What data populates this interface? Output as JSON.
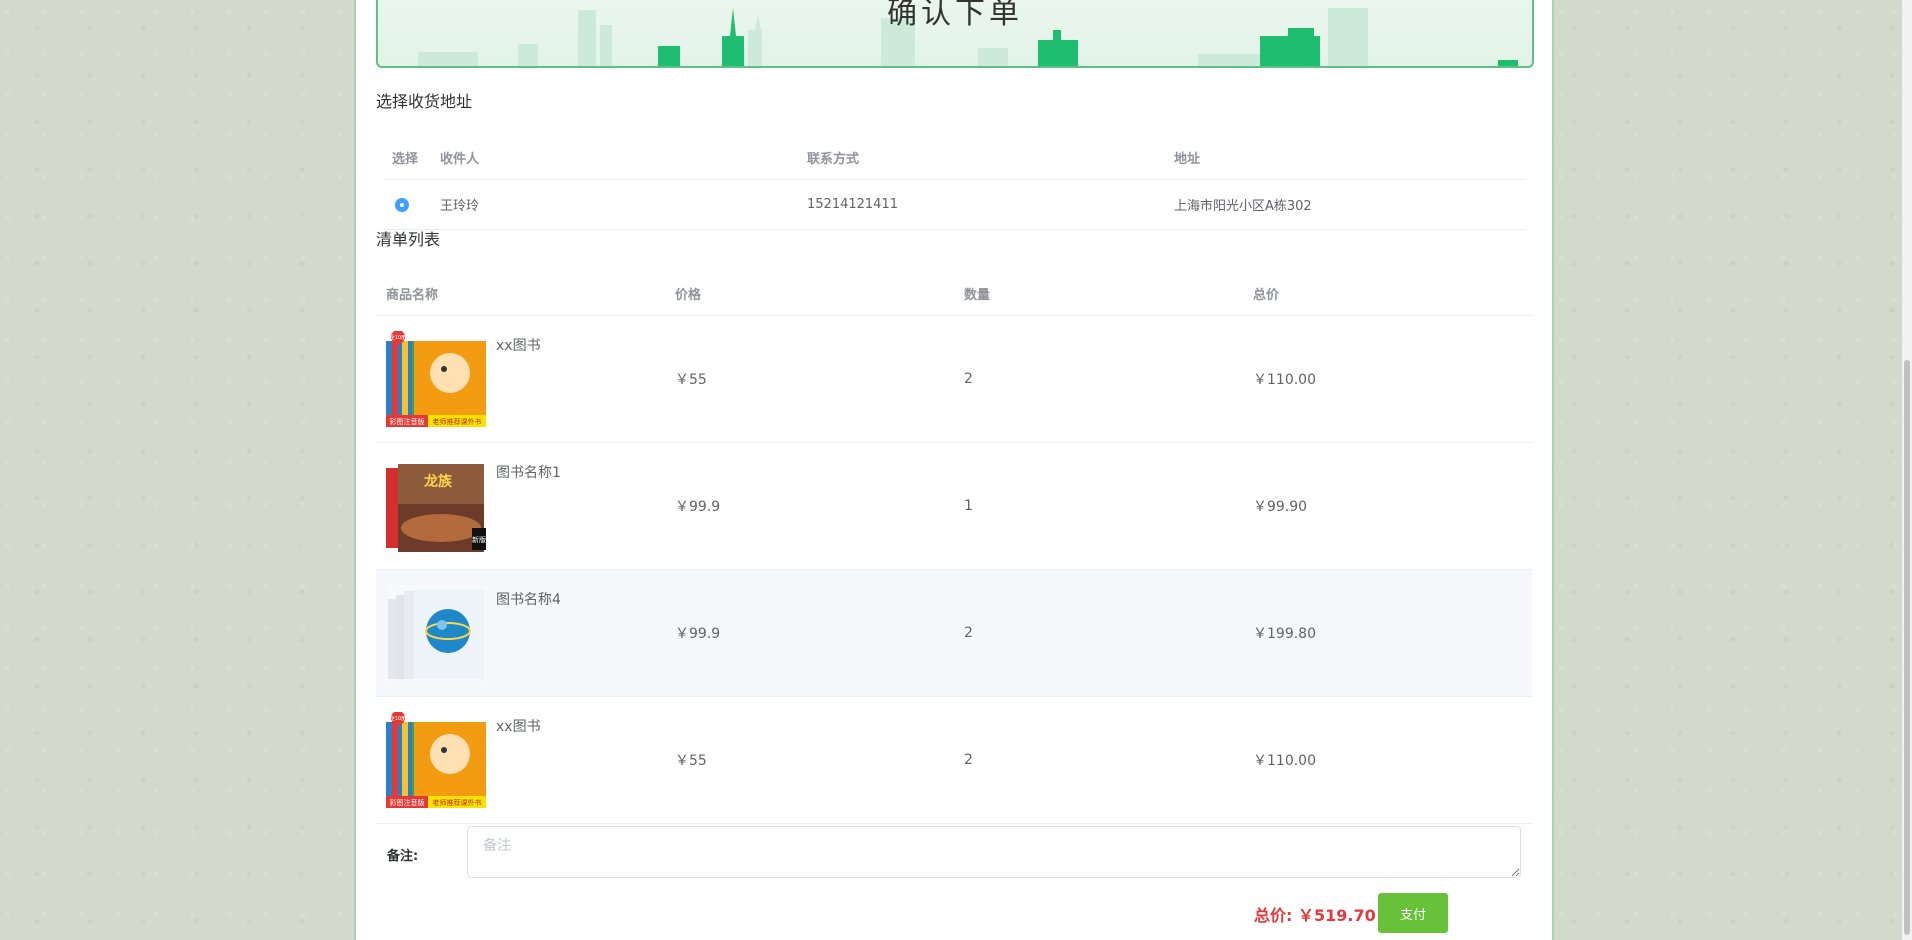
{
  "banner": {
    "title": "确认下单"
  },
  "address_section": {
    "title": "选择收货地址",
    "headers": {
      "select": "选择",
      "receiver": "收件人",
      "phone": "联系方式",
      "address": "地址"
    },
    "rows": [
      {
        "receiver": "王玲玲",
        "phone": "15214121411",
        "address": "上海市阳光小区A栋302",
        "selected": true
      }
    ]
  },
  "cart_section": {
    "title": "清单列表",
    "headers": {
      "name": "商品名称",
      "price": "价格",
      "qty": "数量",
      "total": "总价"
    },
    "rows": [
      {
        "name": "xx图书",
        "price": "￥55",
        "qty": "2",
        "total": "￥110.00",
        "cover": "orange-kids-book-cover-icon",
        "cover_texts": {
          "badge": "全10册",
          "bottom_left": "彩图注音版",
          "bottom_right": "老师推荐课外书"
        }
      },
      {
        "name": "图书名称1",
        "price": "￥99.9",
        "qty": "1",
        "total": "￥99.90",
        "cover": "dragon-book-cover-icon",
        "cover_texts": {
          "title": "龙族",
          "edition": "新版"
        }
      },
      {
        "name": "图书名称4",
        "price": "￥99.9",
        "qty": "2",
        "total": "￥199.80",
        "cover": "blue-globe-book-cover-icon"
      },
      {
        "name": "xx图书",
        "price": "￥55",
        "qty": "2",
        "total": "￥110.00",
        "cover": "orange-kids-book-cover-icon",
        "cover_texts": {
          "badge": "全10册",
          "bottom_left": "彩图注音版",
          "bottom_right": "老师推荐课外书"
        }
      }
    ]
  },
  "remark": {
    "label": "备注:",
    "placeholder": "备注",
    "value": ""
  },
  "summary": {
    "total_label": "总价:",
    "total_value": "￥519.70",
    "pay_label": "支付"
  },
  "colors": {
    "accent_green": "#67c23a",
    "total_red": "#e4393c",
    "radio_blue": "#409eff",
    "banner_border": "#5cc285"
  }
}
